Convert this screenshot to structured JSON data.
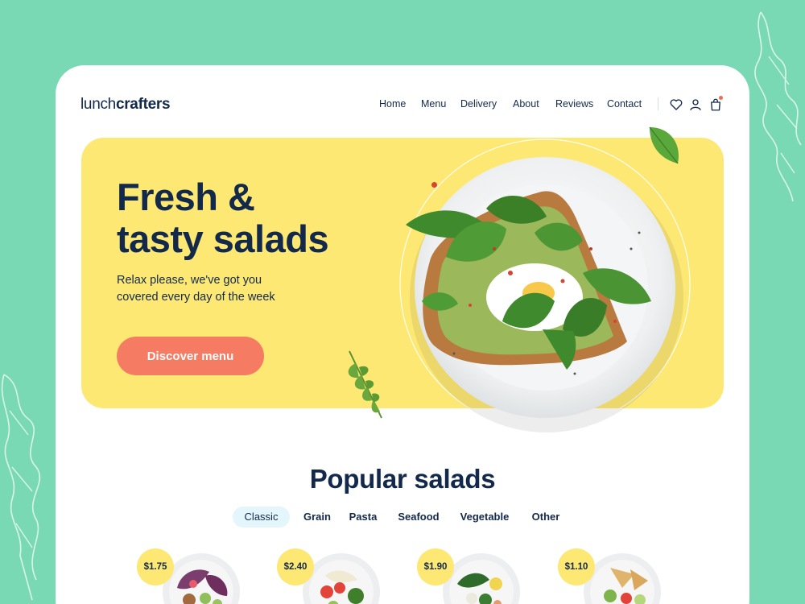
{
  "brand": {
    "logo_light": "lunch",
    "logo_bold": "crafters"
  },
  "nav": {
    "items": [
      "Home",
      "Menu",
      "Delivery",
      "About",
      "Reviews",
      "Contact"
    ]
  },
  "header_icons": [
    "heart-icon",
    "user-icon",
    "cart-icon"
  ],
  "hero": {
    "title_line1": "Fresh &",
    "title_line2": "tasty salads",
    "subtitle_line1": "Relax please, we've got you",
    "subtitle_line2": "covered every day of the week",
    "cta_label": "Discover menu"
  },
  "popular": {
    "title": "Popular salads",
    "tabs": [
      "Classic",
      "Grain",
      "Pasta",
      "Seafood",
      "Vegetable",
      "Other"
    ],
    "active_tab": "Classic",
    "products": [
      {
        "price": "$1.75"
      },
      {
        "price": "$2.40"
      },
      {
        "price": "$1.90"
      },
      {
        "price": "$1.10"
      }
    ]
  },
  "colors": {
    "background": "#7ad9b5",
    "card": "#ffffff",
    "hero": "#fde873",
    "cta": "#f67b63",
    "text_dark": "#13294b",
    "active_tab": "#e3f6fb",
    "notification_dot": "#f26b4f"
  }
}
